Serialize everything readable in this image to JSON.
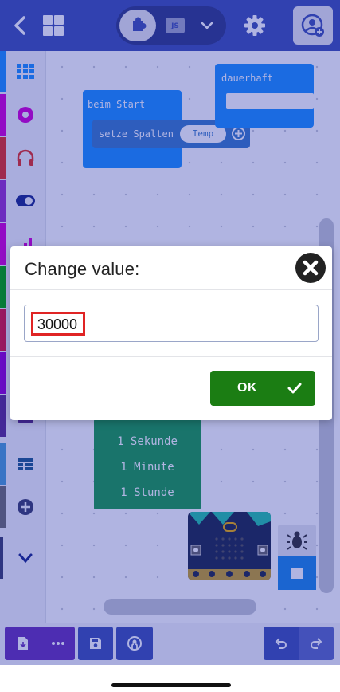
{
  "editor": {
    "blocks_mode_icon": "puzzle-icon",
    "js_label": "JS"
  },
  "toolbox": {
    "categories": [
      {
        "icon": "grid-icon",
        "color": "#1e90ff"
      },
      {
        "icon": "circle-icon",
        "color": "#d400d4"
      },
      {
        "icon": "headphones-icon",
        "color": "#e63022"
      },
      {
        "icon": "toggle-icon",
        "color": "#9932cc"
      },
      {
        "icon": "signal-icon",
        "color": "#d400d4"
      }
    ]
  },
  "workspace": {
    "on_start": {
      "label": "beim Start"
    },
    "set_columns": {
      "label": "setze Spalten",
      "value": "Temp"
    },
    "forever": {
      "label": "dauerhaft"
    },
    "duration_options": [
      "1 Sekunde",
      "1 Minute",
      "1 Stunde"
    ]
  },
  "dialog": {
    "title": "Change value:",
    "value": "30000",
    "ok_label": "OK"
  },
  "colors": {
    "header": "#3f51b5",
    "ok_button": "#1b7d13",
    "highlight": "#e02424"
  }
}
